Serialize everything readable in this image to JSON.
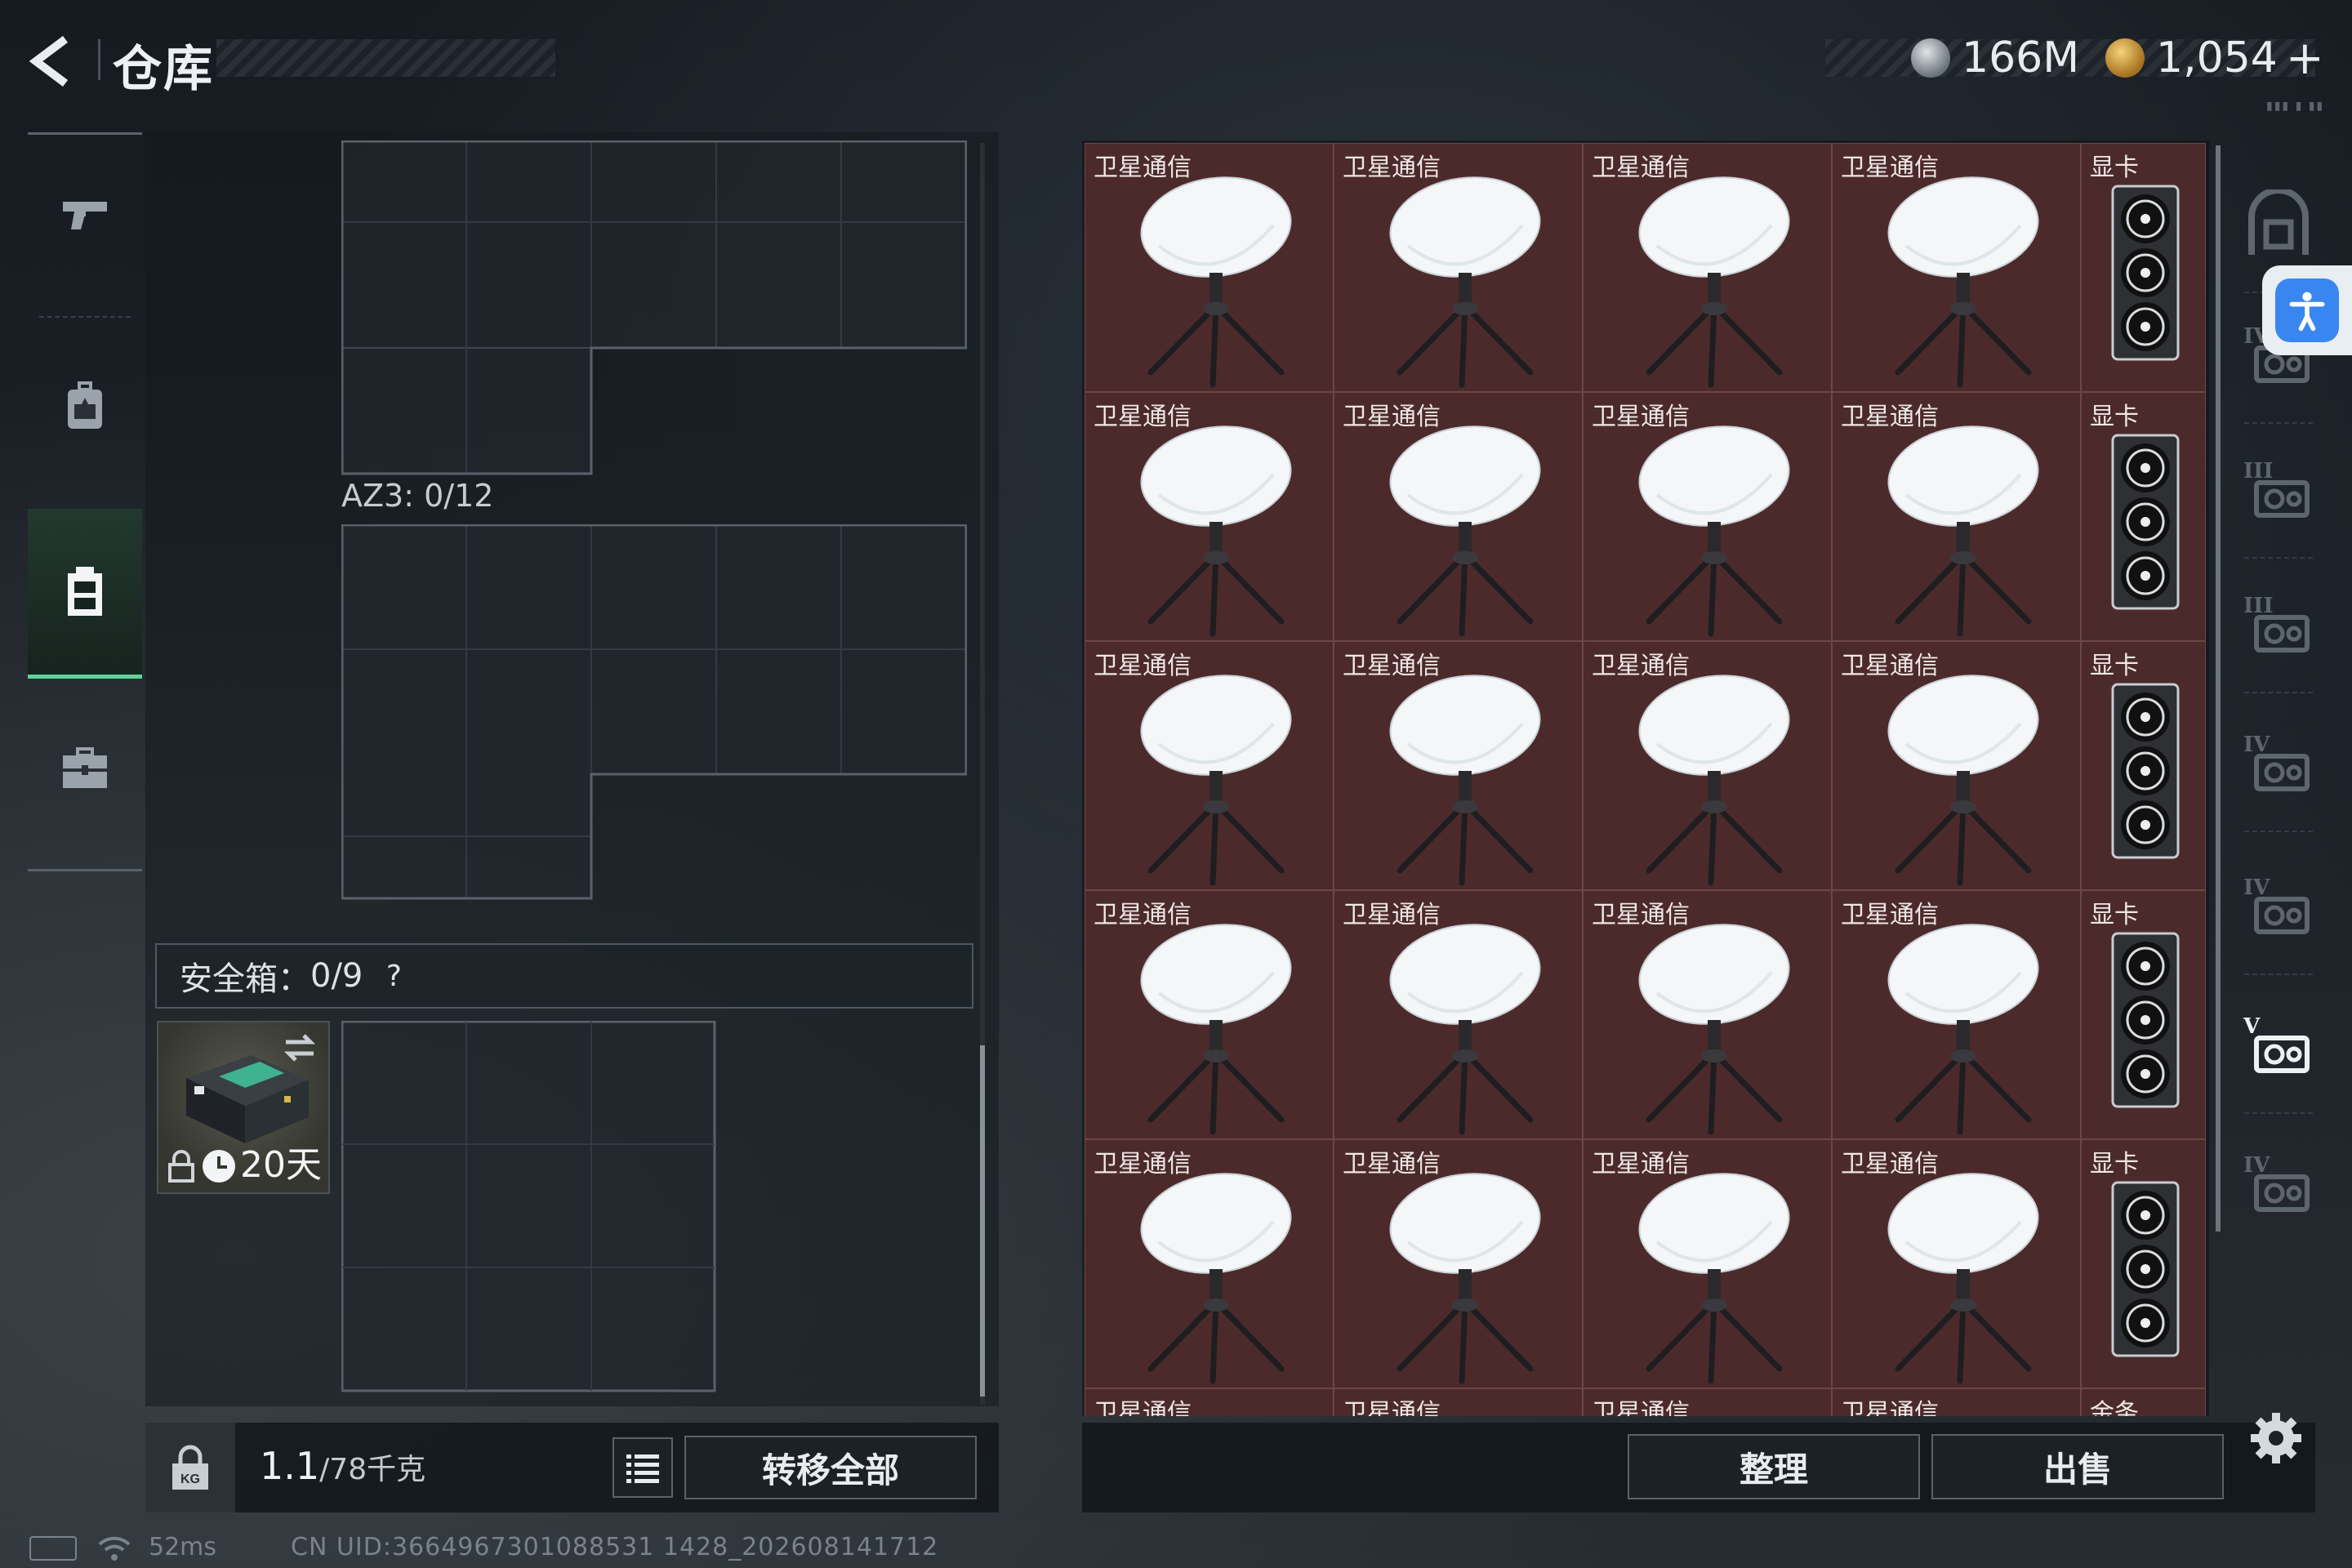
{
  "header": {
    "title": "仓库",
    "currencies": [
      {
        "icon": "silver-coin-icon",
        "value": "166M"
      },
      {
        "icon": "gold-coin-icon",
        "value": "1,054",
        "suffix": "+"
      }
    ]
  },
  "left_rail": {
    "items": [
      {
        "name": "weapon",
        "icon": "pistol-icon",
        "active": false
      },
      {
        "name": "backpack",
        "icon": "backpack-icon",
        "active": false
      },
      {
        "name": "chest-rig",
        "icon": "vest-icon",
        "active": true
      },
      {
        "name": "case",
        "icon": "briefcase-icon",
        "active": false
      }
    ]
  },
  "containers": {
    "az3_label": "AZ3: 0/12"
  },
  "safe_box": {
    "label": "安全箱：",
    "count": "0/9",
    "help": "?",
    "case_time": "20天"
  },
  "left_footer": {
    "weight_value": "1.1",
    "weight_suffix": "/78千克",
    "transfer_label": "转移全部"
  },
  "stash": {
    "colors": {
      "cell_bg": "#4c2a2b",
      "cell_border": "#6d4647"
    },
    "rows": [
      [
        "卫星通信",
        "卫星通信",
        "卫星通信",
        "卫星通信",
        "显卡"
      ],
      [
        "卫星通信",
        "卫星通信",
        "卫星通信",
        "卫星通信",
        "显卡"
      ],
      [
        "卫星通信",
        "卫星通信",
        "卫星通信",
        "卫星通信",
        "显卡"
      ],
      [
        "卫星通信",
        "卫星通信",
        "卫星通信",
        "卫星通信",
        "显卡"
      ],
      [
        "卫星通信",
        "卫星通信",
        "卫星通信",
        "卫星通信",
        "显卡"
      ],
      [
        "卫星通信",
        "卫星通信",
        "卫星通信",
        "卫星通信",
        "金条"
      ]
    ]
  },
  "right_footer": {
    "sort_label": "整理",
    "sell_label": "出售"
  },
  "side_rail": {
    "items": [
      {
        "icon": "storage-tab-icon"
      },
      {
        "icon": "tier-iv-storage-icon"
      },
      {
        "icon": "tier-iii-workbench-icon"
      },
      {
        "icon": "tier-iii-supply-icon"
      },
      {
        "icon": "tier-iv-gpu-icon"
      },
      {
        "icon": "tier-iv-gpu-icon"
      },
      {
        "icon": "tier-v-gpu-icon",
        "active": true
      },
      {
        "icon": "tier-iv-gpu-icon"
      }
    ]
  },
  "status": {
    "ping": "52ms",
    "uid": "CN UID:3664967301088531 1428_202608141712"
  }
}
